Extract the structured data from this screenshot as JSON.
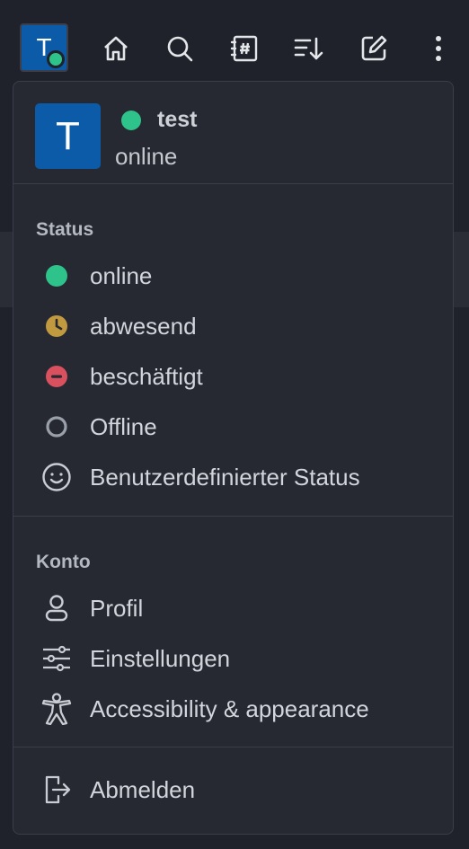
{
  "topbar": {
    "avatar_letter": "T",
    "icons": [
      "home-icon",
      "search-icon",
      "directory-icon",
      "sort-icon",
      "edit-icon",
      "kebab-menu-icon"
    ]
  },
  "menu": {
    "profile": {
      "avatar_letter": "T",
      "name": "test",
      "status": "online"
    },
    "status_section": {
      "title": "Status",
      "items": [
        {
          "label": "online",
          "color": "#2ec38a"
        },
        {
          "label": "abwesend",
          "color": "#c1993e"
        },
        {
          "label": "beschäftigt",
          "color": "#d9505f"
        },
        {
          "label": "Offline",
          "color": "#9aa0aa"
        },
        {
          "label": "Benutzerdefinierter Status"
        }
      ]
    },
    "account_section": {
      "title": "Konto",
      "items": [
        {
          "label": "Profil"
        },
        {
          "label": "Einstellungen"
        },
        {
          "label": "Accessibility & appearance"
        }
      ]
    },
    "logout": {
      "label": "Abmelden"
    }
  }
}
